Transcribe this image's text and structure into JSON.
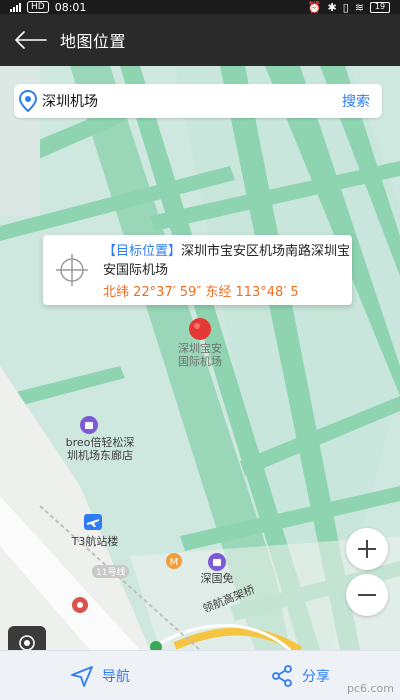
{
  "status_bar": {
    "carrier": "HD",
    "time": "08:01",
    "battery": "19"
  },
  "app_bar": {
    "back_icon": "back-arrow-icon",
    "title": "地图位置"
  },
  "search": {
    "value": "深圳机场",
    "button": "搜索",
    "icon": "location-pin-icon"
  },
  "info_card": {
    "tag": "【目标位置】",
    "address": "深圳市宝安区机场南路深圳宝安国际机场",
    "coords": "北纬 22°37′ 59″ 东经 113°48′ 5"
  },
  "map_labels": {
    "airport": "深圳宝安\n国际机场",
    "breo": "breo倍轻松深\n圳机场东廊店",
    "t3": "T3航站楼",
    "metro_line": "11号线",
    "duty_free": "深国免",
    "road": "领航高架桥"
  },
  "controls": {
    "zoom_in": "+",
    "zoom_out": "−"
  },
  "bottom_actions": [
    {
      "label": "导航",
      "icon": "navigation-arrow-icon"
    },
    {
      "label": "分享",
      "icon": "share-icon"
    }
  ],
  "watermark": "pc6.com",
  "colors": {
    "map_bg": "#cfe8df",
    "runway": "#8fd4b1",
    "accent": "#2f7df4",
    "coords": "#f06f1f",
    "pin_red": "#e53935"
  }
}
